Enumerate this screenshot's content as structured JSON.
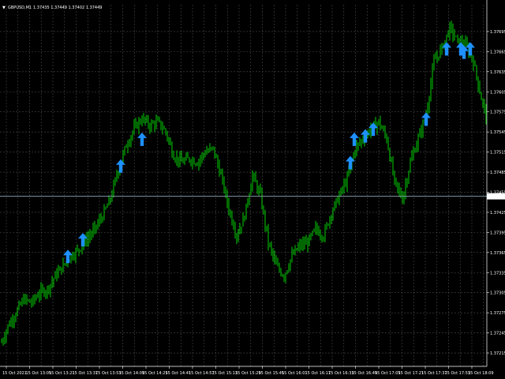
{
  "header": {
    "symbol_label": "GBPUSD,M1",
    "ohlc_values": "1.37435 1.37449 1.37402 1.37449",
    "menu_glyph": "▼"
  },
  "colors": {
    "background": "#000000",
    "grid": "#4a4a4a",
    "candle": "#00e600",
    "arrow": "#1e90ff",
    "price_line": "#8aa0b0",
    "axis_text": "#ffffff",
    "price_tag_bg": "#ffffff",
    "price_tag_text": "#000000"
  },
  "chart_data": {
    "type": "candlestick",
    "symbol": "GBPUSD",
    "timeframe": "M1",
    "current_price": 1.37449,
    "ylim": [
      1.37195,
      1.37735
    ],
    "price_ticks": [
      "1.37695",
      "1.37665",
      "1.37635",
      "1.37605",
      "1.37575",
      "1.37545",
      "1.37515",
      "1.37485",
      "1.37455",
      "1.37425",
      "1.37395",
      "1.37365",
      "1.37335",
      "1.37305",
      "1.37275",
      "1.37245",
      "1.37215"
    ],
    "time_ticks": [
      "15 Oct 2021",
      "15 Oct 13:05",
      "15 Oct 13:21",
      "15 Oct 13:37",
      "15 Oct 13:53",
      "15 Oct 14:09",
      "15 Oct 14:25",
      "15 Oct 14:41",
      "15 Oct 14:57",
      "15 Oct 15:13",
      "15 Oct 15:29",
      "15 Oct 15:45",
      "15 Oct 16:01",
      "15 Oct 16:17",
      "15 Oct 16:33",
      "15 Oct 16:49",
      "15 Oct 17:05",
      "15 Oct 17:21",
      "15 Oct 17:37",
      "15 Oct 17:53",
      "15 Oct 18:09"
    ],
    "price_path": [
      [
        0,
        1.37225
      ],
      [
        10,
        1.37255
      ],
      [
        20,
        1.37275
      ],
      [
        30,
        1.37295
      ],
      [
        40,
        1.3729
      ],
      [
        50,
        1.37305
      ],
      [
        60,
        1.3731
      ],
      [
        70,
        1.3733
      ],
      [
        80,
        1.37345
      ],
      [
        90,
        1.3736
      ],
      [
        100,
        1.3737
      ],
      [
        110,
        1.37385
      ],
      [
        120,
        1.374
      ],
      [
        130,
        1.3742
      ],
      [
        140,
        1.37445
      ],
      [
        150,
        1.3749
      ],
      [
        160,
        1.37525
      ],
      [
        170,
        1.3755
      ],
      [
        180,
        1.37565
      ],
      [
        190,
        1.37555
      ],
      [
        200,
        1.3756
      ],
      [
        210,
        1.37545
      ],
      [
        220,
        1.3751
      ],
      [
        230,
        1.375
      ],
      [
        240,
        1.37505
      ],
      [
        250,
        1.375
      ],
      [
        260,
        1.37515
      ],
      [
        270,
        1.3752
      ],
      [
        280,
        1.3748
      ],
      [
        290,
        1.3743
      ],
      [
        300,
        1.3739
      ],
      [
        310,
        1.3742
      ],
      [
        320,
        1.3748
      ],
      [
        330,
        1.3745
      ],
      [
        340,
        1.3738
      ],
      [
        350,
        1.37345
      ],
      [
        360,
        1.3733
      ],
      [
        370,
        1.3736
      ],
      [
        380,
        1.37375
      ],
      [
        390,
        1.3738
      ],
      [
        400,
        1.374
      ],
      [
        410,
        1.3739
      ],
      [
        420,
        1.37425
      ],
      [
        430,
        1.3745
      ],
      [
        440,
        1.37475
      ],
      [
        450,
        1.3752
      ],
      [
        460,
        1.37535
      ],
      [
        470,
        1.3755
      ],
      [
        480,
        1.3756
      ],
      [
        490,
        1.37535
      ],
      [
        500,
        1.3747
      ],
      [
        510,
        1.37445
      ],
      [
        520,
        1.375
      ],
      [
        530,
        1.37535
      ],
      [
        540,
        1.3757
      ],
      [
        550,
        1.3765
      ],
      [
        560,
        1.3767
      ],
      [
        570,
        1.377
      ],
      [
        580,
        1.3768
      ],
      [
        590,
        1.37675
      ],
      [
        600,
        1.3765
      ],
      [
        610,
        1.37595
      ],
      [
        616,
        1.3757
      ]
    ],
    "signal_arrows": [
      {
        "time": "15 Oct 13:21",
        "price": 1.37355
      },
      {
        "time": "15 Oct 13:37",
        "price": 1.3738
      },
      {
        "time": "15 Oct 13:53",
        "price": 1.3749
      },
      {
        "time": "15 Oct 14:09",
        "price": 1.3753
      },
      {
        "time": "15 Oct 16:33",
        "price": 1.37495
      },
      {
        "time": "15 Oct 16:33",
        "price": 1.3753
      },
      {
        "time": "15 Oct 16:49",
        "price": 1.37535
      },
      {
        "time": "15 Oct 16:49",
        "price": 1.37545
      },
      {
        "time": "15 Oct 17:21",
        "price": 1.3756
      },
      {
        "time": "15 Oct 17:37",
        "price": 1.37665
      },
      {
        "time": "15 Oct 17:53",
        "price": 1.37665
      },
      {
        "time": "15 Oct 17:53",
        "price": 1.3766
      },
      {
        "time": "15 Oct 17:53",
        "price": 1.37665
      }
    ]
  }
}
